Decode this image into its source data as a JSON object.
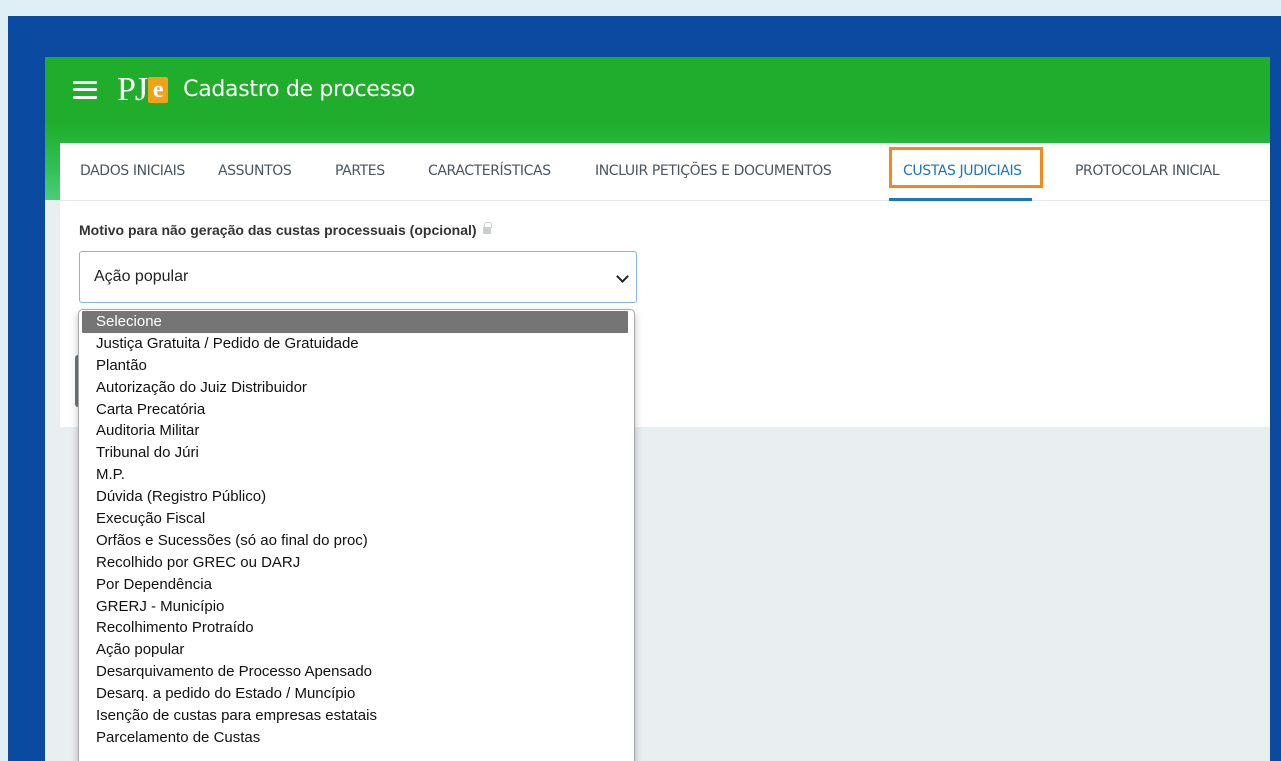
{
  "app": {
    "logo_text": "PJ",
    "logo_badge": "e",
    "title": "Cadastro de processo"
  },
  "tabs": [
    {
      "label": "DADOS INICIAIS"
    },
    {
      "label": "ASSUNTOS"
    },
    {
      "label": "PARTES"
    },
    {
      "label": "CARACTERÍSTICAS"
    },
    {
      "label": "INCLUIR PETIÇÕES E DOCUMENTOS"
    },
    {
      "label": "CUSTAS JUDICIAIS"
    },
    {
      "label": "PROTOCOLAR INICIAL"
    }
  ],
  "active_tab": "CUSTAS JUDICIAIS",
  "form": {
    "label": "Motivo para não geração das custas processuais (opcional)",
    "selected_value": "Ação popular"
  },
  "dropdown": {
    "options": [
      "Selecione",
      "Justiça Gratuita / Pedido de Gratuidade",
      "Plantão",
      "Autorização do Juiz Distribuidor",
      "Carta Precatória",
      "Auditoria Militar",
      "Tribunal do Júri",
      "M.P.",
      "Dúvida (Registro Público)",
      "Execução Fiscal",
      "Orfãos e Sucessões (só ao final do proc)",
      "Recolhido por GREC ou DARJ",
      "Por Dependência",
      "GRERJ - Município",
      "Recolhimento Protraído",
      "Ação popular",
      "Desarquivamento de Processo Apensado",
      "Desarq. a pedido do Estado / Muncípio",
      "Isenção de custas para empresas estatais",
      "Parcelamento de Custas"
    ],
    "highlighted": "Selecione"
  },
  "colors": {
    "topbar": "#1fad2b",
    "frame": "#0a4aa0",
    "active_tab": "#1a77b8",
    "highlight_border": "#f28a20",
    "logo_badge": "#f0a21a"
  }
}
